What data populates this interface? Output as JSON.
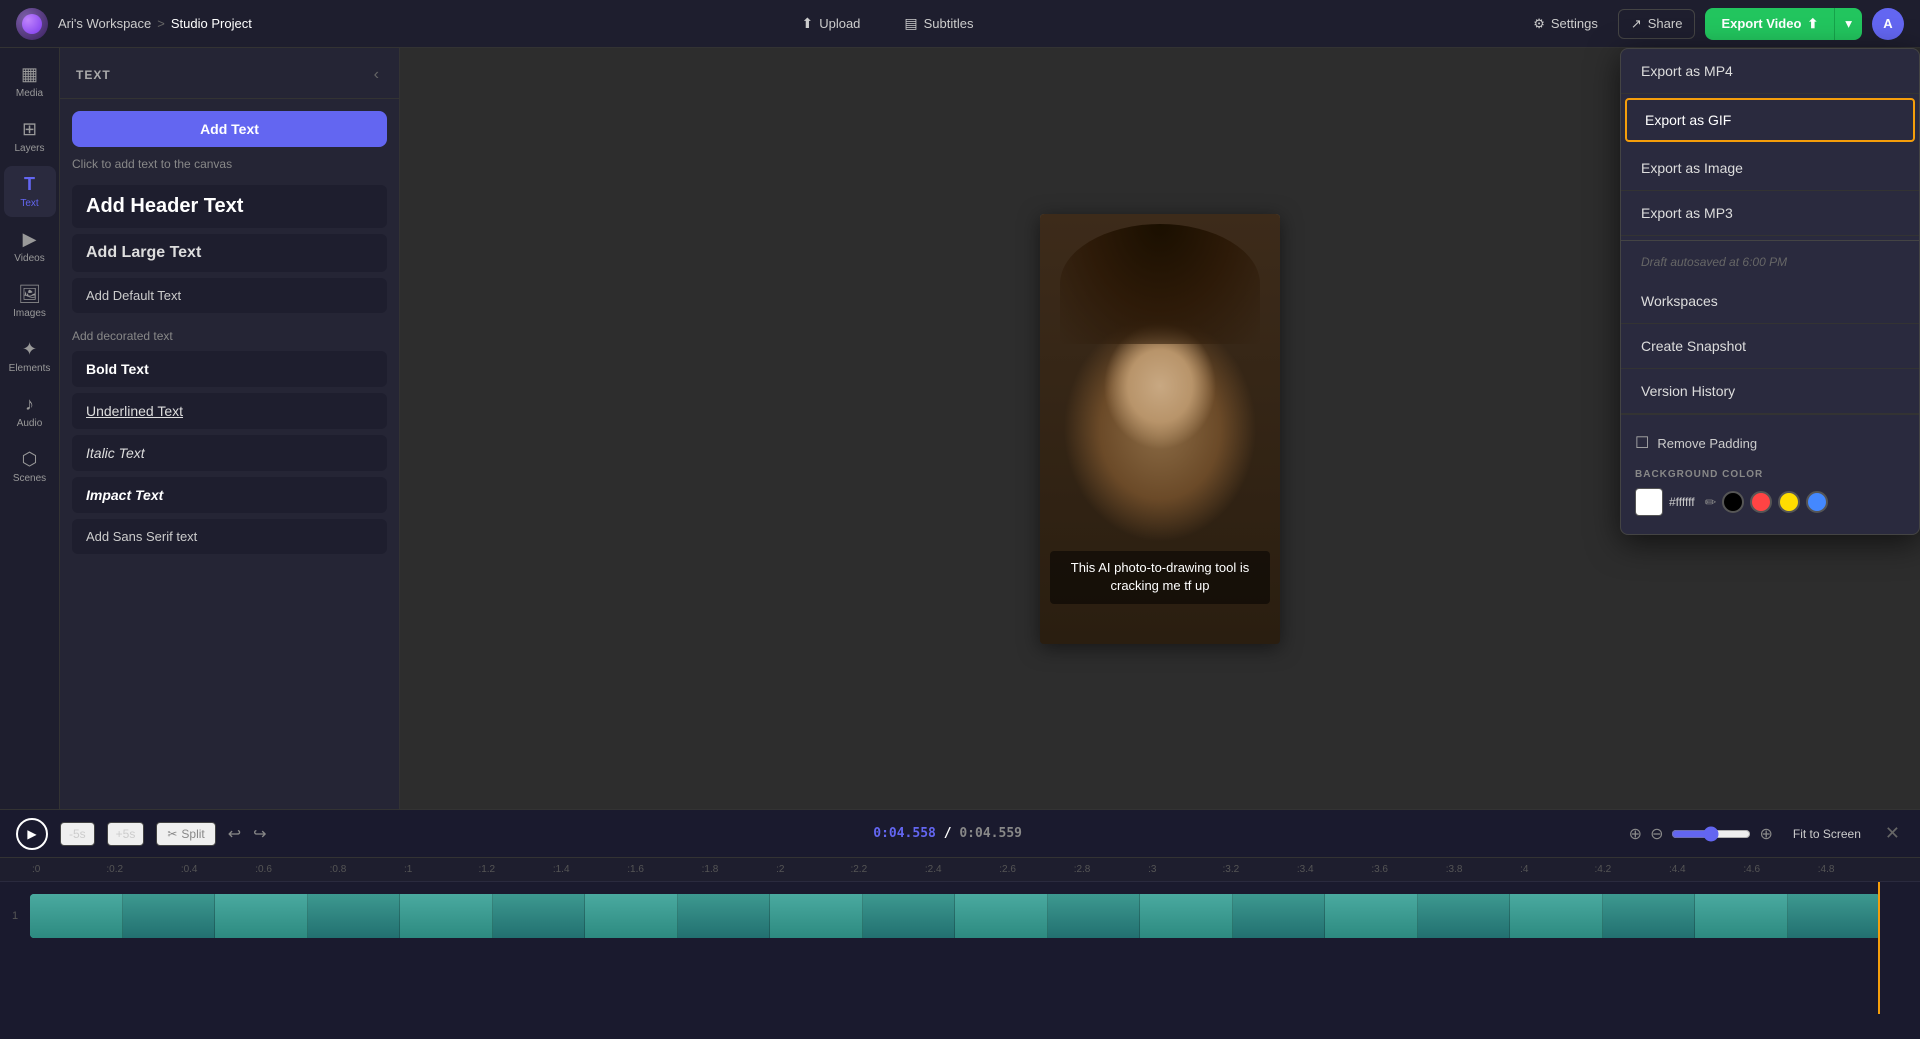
{
  "app": {
    "workspace": "Ari's Workspace",
    "separator": ">",
    "project": "Studio Project"
  },
  "topbar": {
    "upload_label": "Upload",
    "subtitles_label": "Subtitles",
    "settings_label": "Settings",
    "share_label": "Share",
    "export_label": "Export Video",
    "avatar_label": "A"
  },
  "sidebar": {
    "items": [
      {
        "id": "media",
        "label": "Media",
        "icon": "▦"
      },
      {
        "id": "layers",
        "label": "Layers",
        "icon": "⊞"
      },
      {
        "id": "text",
        "label": "Text",
        "icon": "T",
        "active": true
      },
      {
        "id": "videos",
        "label": "Videos",
        "icon": "▶"
      },
      {
        "id": "images",
        "label": "Images",
        "icon": "🖼"
      },
      {
        "id": "elements",
        "label": "Elements",
        "icon": "✦"
      },
      {
        "id": "audio",
        "label": "Audio",
        "icon": "♪"
      },
      {
        "id": "scenes",
        "label": "Scenes",
        "icon": "⬡"
      }
    ]
  },
  "text_panel": {
    "title": "TEXT",
    "add_btn": "Add Text",
    "hint": "Click to add text to the canvas",
    "options": [
      {
        "label": "Add Header Text",
        "style": "header"
      },
      {
        "label": "Add Large Text",
        "style": "large"
      },
      {
        "label": "Add Default Text",
        "style": "default"
      }
    ],
    "section_label": "Add decorated text",
    "decorated": [
      {
        "label": "Bold Text",
        "style": "bold"
      },
      {
        "label": "Underlined Text",
        "style": "underline"
      },
      {
        "label": "Italic Text",
        "style": "italic"
      },
      {
        "label": "Impact Text",
        "style": "impact"
      },
      {
        "label": "Add Sans Serif text",
        "style": "sans"
      }
    ]
  },
  "canvas": {
    "caption": "This AI photo-to-drawing tool is cracking me tf up"
  },
  "export_dropdown": {
    "items": [
      {
        "label": "Export as MP4",
        "highlighted": false
      },
      {
        "label": "Export as GIF",
        "highlighted": true
      },
      {
        "label": "Export as Image",
        "highlighted": false
      },
      {
        "label": "Export as MP3",
        "highlighted": false
      }
    ],
    "autosave": "Draft autosaved at 6:00 PM",
    "workspaces": "Workspaces",
    "snapshot": "Create Snapshot",
    "version_history": "Version History"
  },
  "properties_panel": {
    "remove_padding_label": "Remove Padding",
    "bg_color_section": "BACKGROUND COLOR",
    "color_hex": "#ffffff",
    "swatches": [
      "#000000",
      "#ff4444",
      "#ffdd00",
      "#4488ff"
    ]
  },
  "timeline": {
    "skip_back": "-5s",
    "skip_fwd": "+5s",
    "split": "Split",
    "time_current": "0:04.558",
    "time_total": "0:04.559",
    "fit_screen": "Fit to Screen",
    "ruler_marks": [
      ":0",
      ":0.2",
      ":0.4",
      ":0.6",
      ":0.8",
      ":1",
      ":1.2",
      ":1.4",
      ":1.6",
      ":1.8",
      ":2",
      ":2.2",
      ":2.4",
      ":2.6",
      ":2.8",
      ":3",
      ":3.2",
      ":3.4",
      ":3.6",
      ":3.8",
      ":4",
      ":4.2",
      ":4.4",
      ":4.6",
      ":4.8"
    ]
  }
}
